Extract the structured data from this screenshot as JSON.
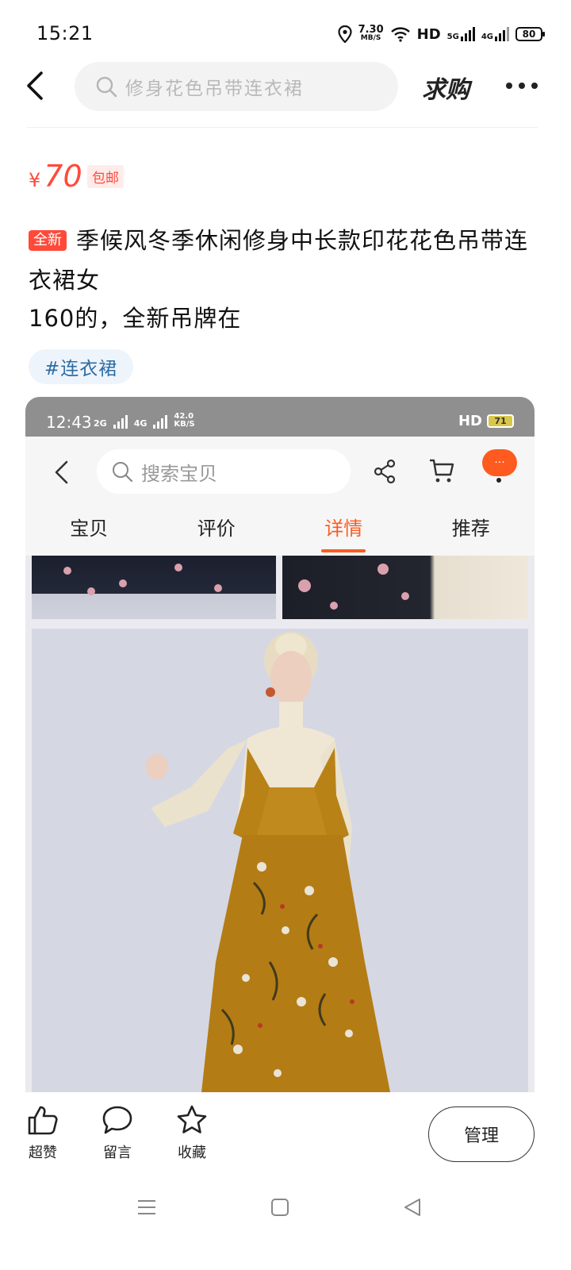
{
  "status_bar": {
    "time": "15:21",
    "speed_value": "7.30",
    "speed_unit": "MB/S",
    "hd_label": "HD",
    "net1": "5G",
    "net2": "4G",
    "battery": "80"
  },
  "nav": {
    "search_placeholder": "修身花色吊带连衣裙",
    "buy_label": "求购"
  },
  "listing": {
    "price_currency": "¥",
    "price": "70",
    "shipping_badge": "包邮",
    "condition_badge": "全新",
    "title": "季候风冬季休闲修身中长款印花花色吊带连衣裙女",
    "description": "160的，全新吊牌在",
    "tag": "#连衣裙"
  },
  "embedded_screenshot": {
    "time": "12:43",
    "net1": "2G",
    "net2": "4G",
    "speed_value": "42.0",
    "speed_unit": "KB/S",
    "hd_label": "HD",
    "battery": "71",
    "search_placeholder": "搜索宝贝",
    "msg_badge": "···",
    "tabs": [
      {
        "label": "宝贝"
      },
      {
        "label": "评价"
      },
      {
        "label": "详情"
      },
      {
        "label": "推荐"
      }
    ],
    "active_tab": "详情"
  },
  "actions": {
    "like_label": "超赞",
    "comment_label": "留言",
    "favorite_label": "收藏",
    "manage_label": "管理"
  },
  "colors": {
    "price_red": "#ff4a3a",
    "accent_orange": "#ff5a1f",
    "tag_blue": "#2d6da3"
  }
}
